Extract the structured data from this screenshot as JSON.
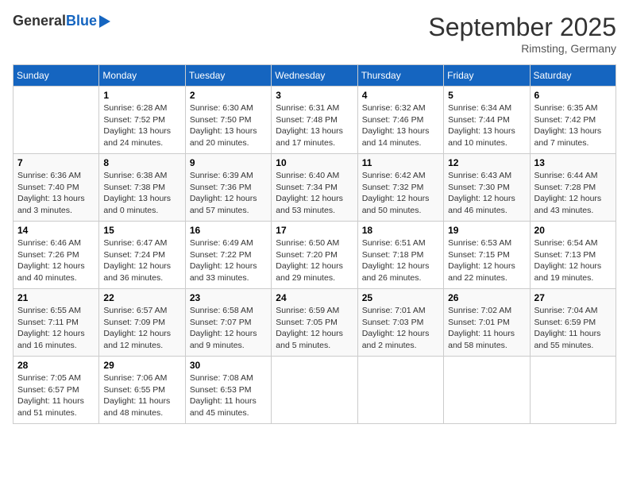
{
  "logo": {
    "general": "General",
    "blue": "Blue"
  },
  "header": {
    "title": "September 2025",
    "location": "Rimsting, Germany"
  },
  "weekdays": [
    "Sunday",
    "Monday",
    "Tuesday",
    "Wednesday",
    "Thursday",
    "Friday",
    "Saturday"
  ],
  "weeks": [
    [
      {
        "day": "",
        "text": ""
      },
      {
        "day": "1",
        "text": "Sunrise: 6:28 AM\nSunset: 7:52 PM\nDaylight: 13 hours\nand 24 minutes."
      },
      {
        "day": "2",
        "text": "Sunrise: 6:30 AM\nSunset: 7:50 PM\nDaylight: 13 hours\nand 20 minutes."
      },
      {
        "day": "3",
        "text": "Sunrise: 6:31 AM\nSunset: 7:48 PM\nDaylight: 13 hours\nand 17 minutes."
      },
      {
        "day": "4",
        "text": "Sunrise: 6:32 AM\nSunset: 7:46 PM\nDaylight: 13 hours\nand 14 minutes."
      },
      {
        "day": "5",
        "text": "Sunrise: 6:34 AM\nSunset: 7:44 PM\nDaylight: 13 hours\nand 10 minutes."
      },
      {
        "day": "6",
        "text": "Sunrise: 6:35 AM\nSunset: 7:42 PM\nDaylight: 13 hours\nand 7 minutes."
      }
    ],
    [
      {
        "day": "7",
        "text": "Sunrise: 6:36 AM\nSunset: 7:40 PM\nDaylight: 13 hours\nand 3 minutes."
      },
      {
        "day": "8",
        "text": "Sunrise: 6:38 AM\nSunset: 7:38 PM\nDaylight: 13 hours\nand 0 minutes."
      },
      {
        "day": "9",
        "text": "Sunrise: 6:39 AM\nSunset: 7:36 PM\nDaylight: 12 hours\nand 57 minutes."
      },
      {
        "day": "10",
        "text": "Sunrise: 6:40 AM\nSunset: 7:34 PM\nDaylight: 12 hours\nand 53 minutes."
      },
      {
        "day": "11",
        "text": "Sunrise: 6:42 AM\nSunset: 7:32 PM\nDaylight: 12 hours\nand 50 minutes."
      },
      {
        "day": "12",
        "text": "Sunrise: 6:43 AM\nSunset: 7:30 PM\nDaylight: 12 hours\nand 46 minutes."
      },
      {
        "day": "13",
        "text": "Sunrise: 6:44 AM\nSunset: 7:28 PM\nDaylight: 12 hours\nand 43 minutes."
      }
    ],
    [
      {
        "day": "14",
        "text": "Sunrise: 6:46 AM\nSunset: 7:26 PM\nDaylight: 12 hours\nand 40 minutes."
      },
      {
        "day": "15",
        "text": "Sunrise: 6:47 AM\nSunset: 7:24 PM\nDaylight: 12 hours\nand 36 minutes."
      },
      {
        "day": "16",
        "text": "Sunrise: 6:49 AM\nSunset: 7:22 PM\nDaylight: 12 hours\nand 33 minutes."
      },
      {
        "day": "17",
        "text": "Sunrise: 6:50 AM\nSunset: 7:20 PM\nDaylight: 12 hours\nand 29 minutes."
      },
      {
        "day": "18",
        "text": "Sunrise: 6:51 AM\nSunset: 7:18 PM\nDaylight: 12 hours\nand 26 minutes."
      },
      {
        "day": "19",
        "text": "Sunrise: 6:53 AM\nSunset: 7:15 PM\nDaylight: 12 hours\nand 22 minutes."
      },
      {
        "day": "20",
        "text": "Sunrise: 6:54 AM\nSunset: 7:13 PM\nDaylight: 12 hours\nand 19 minutes."
      }
    ],
    [
      {
        "day": "21",
        "text": "Sunrise: 6:55 AM\nSunset: 7:11 PM\nDaylight: 12 hours\nand 16 minutes."
      },
      {
        "day": "22",
        "text": "Sunrise: 6:57 AM\nSunset: 7:09 PM\nDaylight: 12 hours\nand 12 minutes."
      },
      {
        "day": "23",
        "text": "Sunrise: 6:58 AM\nSunset: 7:07 PM\nDaylight: 12 hours\nand 9 minutes."
      },
      {
        "day": "24",
        "text": "Sunrise: 6:59 AM\nSunset: 7:05 PM\nDaylight: 12 hours\nand 5 minutes."
      },
      {
        "day": "25",
        "text": "Sunrise: 7:01 AM\nSunset: 7:03 PM\nDaylight: 12 hours\nand 2 minutes."
      },
      {
        "day": "26",
        "text": "Sunrise: 7:02 AM\nSunset: 7:01 PM\nDaylight: 11 hours\nand 58 minutes."
      },
      {
        "day": "27",
        "text": "Sunrise: 7:04 AM\nSunset: 6:59 PM\nDaylight: 11 hours\nand 55 minutes."
      }
    ],
    [
      {
        "day": "28",
        "text": "Sunrise: 7:05 AM\nSunset: 6:57 PM\nDaylight: 11 hours\nand 51 minutes."
      },
      {
        "day": "29",
        "text": "Sunrise: 7:06 AM\nSunset: 6:55 PM\nDaylight: 11 hours\nand 48 minutes."
      },
      {
        "day": "30",
        "text": "Sunrise: 7:08 AM\nSunset: 6:53 PM\nDaylight: 11 hours\nand 45 minutes."
      },
      {
        "day": "",
        "text": ""
      },
      {
        "day": "",
        "text": ""
      },
      {
        "day": "",
        "text": ""
      },
      {
        "day": "",
        "text": ""
      }
    ]
  ]
}
